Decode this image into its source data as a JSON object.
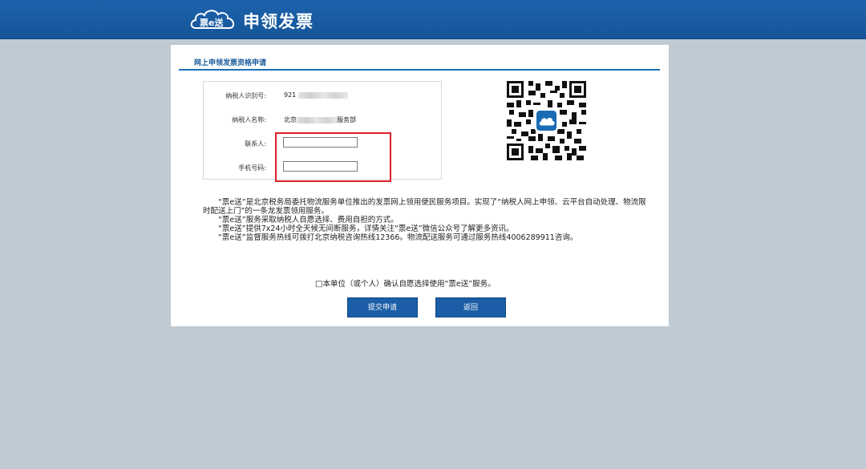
{
  "header": {
    "logo_text": "票e送",
    "title": "申领发票",
    "brand_color": "#1a5ea8"
  },
  "panel": {
    "title": "网上申领发票资格申请",
    "form": {
      "taxpayer_id_label": "纳税人识别号:",
      "taxpayer_id_value": "921",
      "taxpayer_name_label": "纳税人名称:",
      "taxpayer_name_prefix": "北京",
      "taxpayer_name_suffix": "服务部",
      "contact_label": "联系人:",
      "contact_value": "",
      "phone_label": "手机号码:",
      "phone_value": ""
    },
    "description": [
      "“票e送”是北京税务局委托物流服务单位推出的发票网上领用便民服务项目。实现了“纳税人网上申领、云平台自动处理、物流限时配送上门”的一条龙发票领用服务。",
      "“票e送”服务采取纳税人自愿选择、费用自担的方式。",
      "“票e送”提供7x24小时全天候无间断服务，详情关注“票e送”微信公众号了解更多资讯。",
      "“票e送”监督服务热线可拨打北京纳税咨询热线12366。物流配送服务可通过服务热线4006289911咨询。"
    ],
    "agreement": {
      "checkbox_glyph": "□",
      "text": "本单位（或个人）确认自愿选择使用“票e送”服务。"
    },
    "buttons": {
      "submit": "提交申请",
      "back": "返回"
    }
  },
  "colors": {
    "highlight": "#d9232b",
    "button": "#1b5ea7"
  }
}
